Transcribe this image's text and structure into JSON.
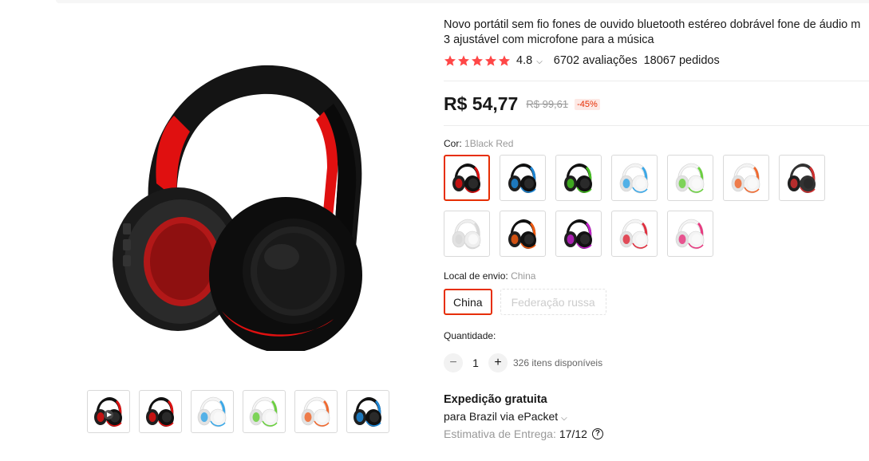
{
  "product": {
    "title_line1": "Novo portátil sem fio fones de ouvido bluetooth estéreo dobrável fone de áudio m",
    "title_line2": "3 ajustável com microfone para a música",
    "rating": "4.8",
    "reviews": "6702 avaliações",
    "orders": "18067 pedidos",
    "price": "R$ 54,77",
    "old_price": "R$ 99,61",
    "discount": "-45%"
  },
  "colors": {
    "star": "#ff4747",
    "accent": "#e62e04"
  },
  "color_selector": {
    "label": "Cor:",
    "selected": "1Black Red",
    "options": [
      {
        "name": "1Black Red",
        "band": "#111111",
        "accent": "#e01010"
      },
      {
        "name": "Black Blue",
        "band": "#111111",
        "accent": "#1e88d8"
      },
      {
        "name": "Black Green",
        "band": "#111111",
        "accent": "#44c020"
      },
      {
        "name": "White Blue",
        "band": "#f4f4f4",
        "accent": "#3aa8e8"
      },
      {
        "name": "White Green",
        "band": "#f4f4f4",
        "accent": "#6bd040"
      },
      {
        "name": "White Orange",
        "band": "#f4f4f4",
        "accent": "#f06a30"
      },
      {
        "name": "Black Gray",
        "band": "#333333",
        "accent": "#d03030"
      },
      {
        "name": "White",
        "band": "#eeeeee",
        "accent": "#d8d8d8"
      },
      {
        "name": "Black Orange",
        "band": "#111111",
        "accent": "#f05a10"
      },
      {
        "name": "Black Purple",
        "band": "#111111",
        "accent": "#c020c8"
      },
      {
        "name": "White Red",
        "band": "#f4f4f4",
        "accent": "#e03040"
      },
      {
        "name": "White Pink",
        "band": "#f4f4f4",
        "accent": "#e83a80"
      }
    ]
  },
  "shipping_from": {
    "label": "Local de envio:",
    "selected": "China",
    "options": [
      "China",
      "Federação russa"
    ]
  },
  "quantity": {
    "label": "Quantidade:",
    "value": "1",
    "minus": "−",
    "plus": "+",
    "available": "326 itens disponíveis"
  },
  "delivery": {
    "title": "Expedição gratuita",
    "via": "para Brazil via ePacket",
    "eta_label": "Estimativa de Entrega:",
    "eta_date": "17/12",
    "help": "?"
  },
  "gallery": {
    "thumbs": [
      {
        "band": "#111111",
        "accent": "#e01010",
        "icon": "play-icon"
      },
      {
        "band": "#111111",
        "accent": "#e01010"
      },
      {
        "band": "#f4f4f4",
        "accent": "#3aa8e8"
      },
      {
        "band": "#f4f4f4",
        "accent": "#6bd040"
      },
      {
        "band": "#f4f4f4",
        "accent": "#f06a30"
      },
      {
        "band": "#111111",
        "accent": "#1e88d8"
      }
    ]
  }
}
